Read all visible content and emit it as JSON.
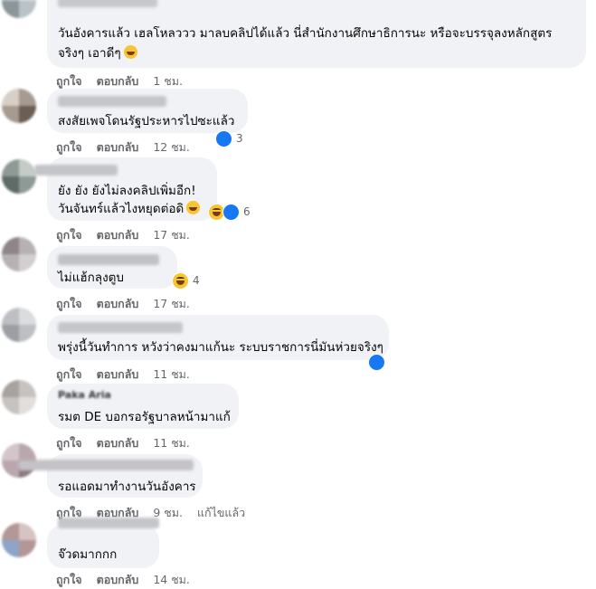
{
  "comments": [
    {
      "lines": [
        "วันอังคารแล้ว เฮลโหลววว มาลบคลิปได้แล้ว นี่สำนักงานศึกษาธิการนะ หรือจะบรรจุลงหลักสูตร",
        "จริงๆ เอาดีๆ"
      ],
      "emoji": "haha-emoji",
      "time": "1 ชม."
    },
    {
      "lines": [
        "สงสัยเพจโดนรัฐประหารไปซะแล้ว"
      ],
      "time": "12 ชม.",
      "reaction_count": "3"
    },
    {
      "lines": [
        "ยัง ยัง ยังไม่ลงคลิปเพิ่มอีก!",
        "วันจันทร์แล้วไงหยุดต่อดิ"
      ],
      "emoji": "rofl-emoji",
      "time": "17 ชม.",
      "reaction_count": "6"
    },
    {
      "lines": [
        "ไม่แฮ้กลุงตูบ"
      ],
      "time": "17 ชม.",
      "reaction_count": "4"
    },
    {
      "lines": [
        "พรุ่งนี้วันทำการ หวังว่าคงมาแก้นะ ระบบราชการนี่มันห่วยจริงๆ"
      ],
      "time": "11 ชม."
    },
    {
      "name": "Paka Aria",
      "lines": [
        "รมต DE บอกรอรัฐบาลหน้ามาแก้"
      ],
      "time": "11 ชม."
    },
    {
      "lines": [
        "รอแอดมาทำงานวันอังคาร"
      ],
      "time": "9 ชม.",
      "edited": "แก้ไขแล้ว"
    },
    {
      "lines": [
        "จ๊วดมากกก"
      ],
      "time": "14 ชม."
    }
  ],
  "actions": {
    "like": "ถูกใจ",
    "reply": "ตอบกลับ"
  },
  "colors": {
    "bubble": "#f0f2f5",
    "like": "#1877f2",
    "haha": "#f7c531",
    "meta": "#65676b"
  }
}
